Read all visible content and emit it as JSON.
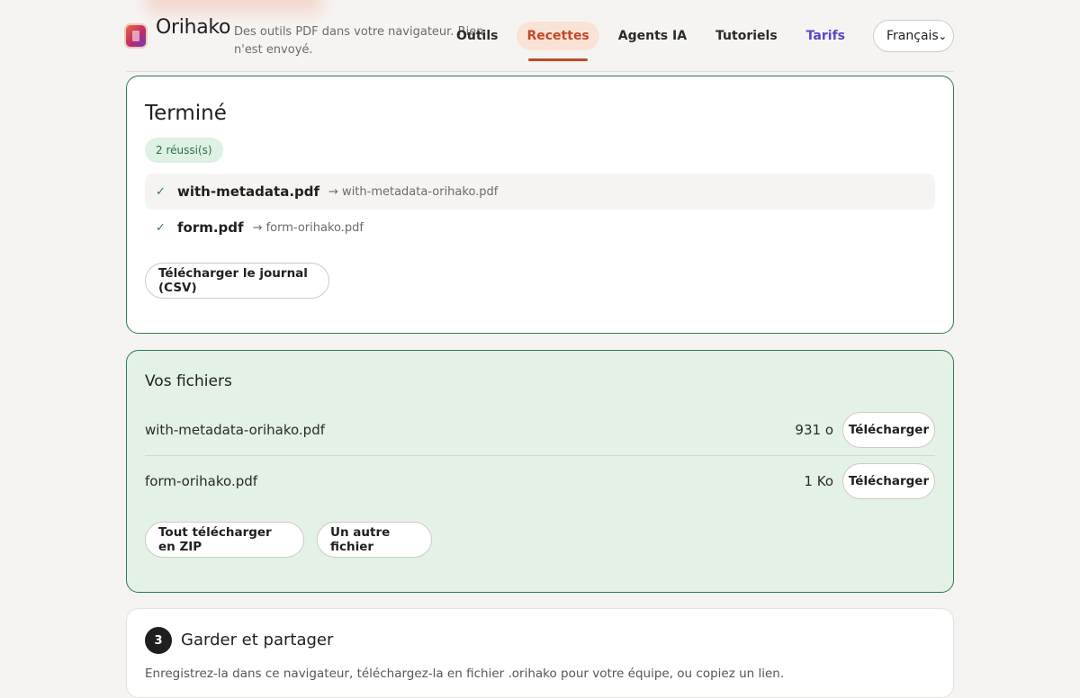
{
  "header": {
    "brand": "Orihako",
    "tagline": "Des outils PDF dans votre navigateur. Rien n'est envoyé.",
    "nav": [
      {
        "label": "Outils"
      },
      {
        "label": "Recettes",
        "active": true
      },
      {
        "label": "Agents IA"
      },
      {
        "label": "Tutoriels"
      },
      {
        "label": "Tarifs"
      }
    ],
    "language": "Français"
  },
  "result": {
    "title": "Terminé",
    "badge": "2 réussi(s)",
    "items": [
      {
        "source": "with-metadata.pdf",
        "output": "→ with-metadata-orihako.pdf"
      },
      {
        "source": "form.pdf",
        "output": "→ form-orihako.pdf"
      }
    ],
    "download_log_label": "Télécharger le journal (CSV)"
  },
  "files": {
    "title": "Vos fichiers",
    "items": [
      {
        "name": "with-metadata-orihako.pdf",
        "size": "931 o",
        "download_label": "Télécharger"
      },
      {
        "name": "form-orihako.pdf",
        "size": "1 Ko",
        "download_label": "Télécharger"
      }
    ],
    "zip_label": "Tout télécharger en ZIP",
    "another_label": "Un autre fichier"
  },
  "share": {
    "step": "3",
    "title": "Garder et partager",
    "description": "Enregistrez-la dans ce navigateur, téléchargez-la en fichier .orihako pour votre équipe, ou copiez un lien."
  },
  "colors": {
    "accent": "#c0492a",
    "success": "#2f7a4e",
    "tarifs": "#5a45c8"
  }
}
